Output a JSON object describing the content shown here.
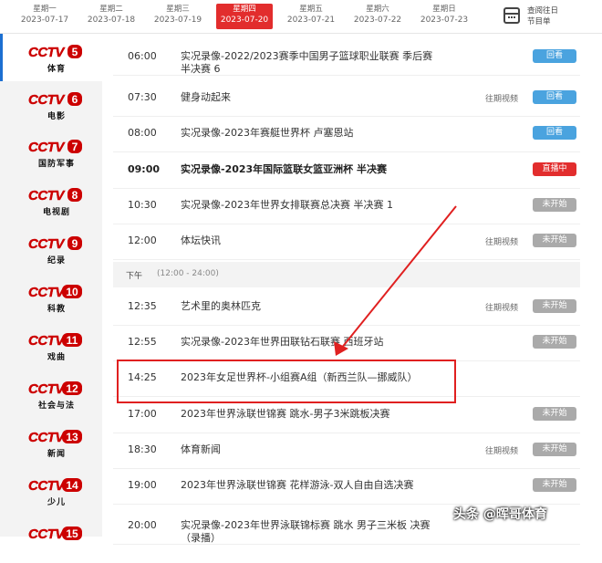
{
  "date_tabs": [
    {
      "weekday": "星期一",
      "date": "2023-07-17"
    },
    {
      "weekday": "星期二",
      "date": "2023-07-18"
    },
    {
      "weekday": "星期三",
      "date": "2023-07-19"
    },
    {
      "weekday": "星期四",
      "date": "2023-07-20",
      "active": true
    },
    {
      "weekday": "星期五",
      "date": "2023-07-21"
    },
    {
      "weekday": "星期六",
      "date": "2023-07-22"
    },
    {
      "weekday": "星期日",
      "date": "2023-07-23"
    }
  ],
  "calendar": {
    "line1": "查阅往日",
    "line2": "节目单",
    "icon": "calendar-icon"
  },
  "channels": [
    {
      "num": "5",
      "name": "体育",
      "active": true
    },
    {
      "num": "6",
      "name": "电影"
    },
    {
      "num": "7",
      "name": "国防军事"
    },
    {
      "num": "8",
      "name": "电视剧"
    },
    {
      "num": "9",
      "name": "纪录"
    },
    {
      "num": "10",
      "name": "科教"
    },
    {
      "num": "11",
      "name": "戏曲"
    },
    {
      "num": "12",
      "name": "社会与法"
    },
    {
      "num": "13",
      "name": "新闻"
    },
    {
      "num": "14",
      "name": "少儿"
    },
    {
      "num": "15",
      "name": ""
    }
  ],
  "logo_text": "CCTV",
  "programs_am": [
    {
      "time": "06:00",
      "title": "实况录像-2022/2023赛季中国男子篮球职业联赛 季后赛 半决赛 6",
      "replay": "",
      "status": "回看",
      "kind": "blue"
    },
    {
      "time": "07:30",
      "title": "健身动起来",
      "replay": "往期视频",
      "status": "回看",
      "kind": "blue"
    },
    {
      "time": "08:00",
      "title": "实况录像-2023年赛艇世界杯 卢塞恩站",
      "replay": "",
      "status": "回看",
      "kind": "blue"
    },
    {
      "time": "09:00",
      "title": "实况录像-2023年国际篮联女篮亚洲杯 半决赛",
      "replay": "",
      "status": "直播中",
      "kind": "red",
      "bold": true
    },
    {
      "time": "10:30",
      "title": "实况录像-2023年世界女排联赛总决赛 半决赛 1",
      "replay": "",
      "status": "未开始",
      "kind": "gray"
    },
    {
      "time": "12:00",
      "title": "体坛快讯",
      "replay": "往期视频",
      "status": "未开始",
      "kind": "gray"
    }
  ],
  "section": {
    "label": "下午",
    "range": "(12:00 - 24:00)"
  },
  "programs_pm": [
    {
      "time": "12:35",
      "title": "艺术里的奥林匹克",
      "replay": "往期视频",
      "status": "未开始",
      "kind": "gray"
    },
    {
      "time": "12:55",
      "title": "实况录像-2023年世界田联钻石联赛 西班牙站",
      "replay": "",
      "status": "未开始",
      "kind": "gray"
    },
    {
      "time": "14:25",
      "title": "2023年女足世界杯-小组赛A组（新西兰队—挪威队）",
      "replay": "",
      "status": "",
      "kind": "none"
    },
    {
      "time": "17:00",
      "title": "2023年世界泳联世锦赛 跳水-男子3米跳板决赛",
      "replay": "",
      "status": "未开始",
      "kind": "gray"
    },
    {
      "time": "18:30",
      "title": "体育新闻",
      "replay": "往期视频",
      "status": "未开始",
      "kind": "gray"
    },
    {
      "time": "19:00",
      "title": "2023年世界泳联世锦赛 花样游泳-双人自由自选决赛",
      "replay": "",
      "status": "未开始",
      "kind": "gray"
    },
    {
      "time": "20:00",
      "title": "实况录像-2023年世界泳联锦标赛 跳水 男子三米板 决赛（录播）",
      "replay": "",
      "status": "",
      "kind": "gray"
    }
  ],
  "watermark": "头条 @晖哥体育",
  "colors": {
    "accent_red": "#e22d2d",
    "replay_blue": "#4aa3df",
    "pending_gray": "#aaaaaa"
  }
}
